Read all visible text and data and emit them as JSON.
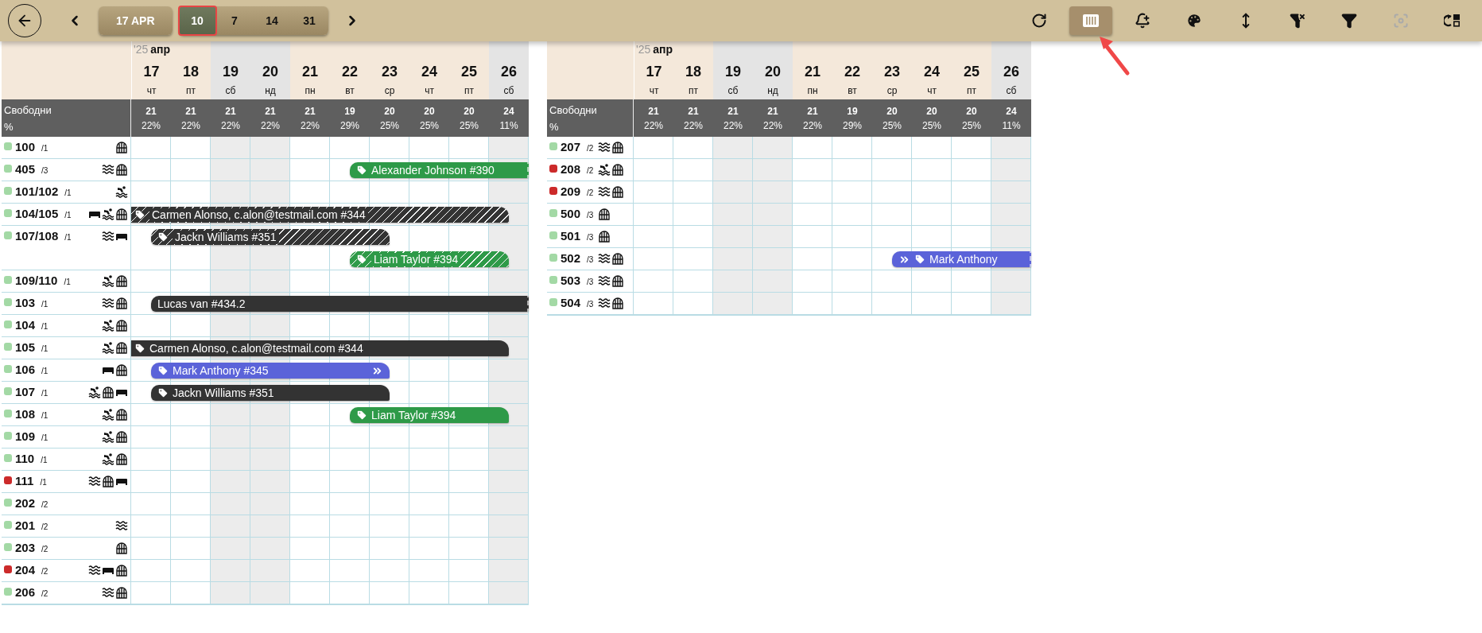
{
  "toolbar": {
    "period": "17 APR",
    "pointer_arrow": true,
    "ranges": [
      {
        "label": "10",
        "selected": true,
        "highlighted": true
      },
      {
        "label": "7",
        "selected": false,
        "highlighted": false
      },
      {
        "label": "14",
        "selected": false,
        "highlighted": false
      },
      {
        "label": "31",
        "selected": false,
        "highlighted": false
      }
    ],
    "tools": [
      {
        "kind": "refresh",
        "active": false,
        "disabled": false
      },
      {
        "kind": "columns",
        "active": true,
        "disabled": false
      },
      {
        "kind": "bell-plus",
        "active": false,
        "disabled": false
      },
      {
        "kind": "palette",
        "active": false,
        "disabled": false
      },
      {
        "kind": "height",
        "active": false,
        "disabled": false
      },
      {
        "kind": "filter-off",
        "active": false,
        "disabled": false
      },
      {
        "kind": "filter",
        "active": false,
        "disabled": false
      },
      {
        "kind": "focus",
        "active": false,
        "disabled": true
      },
      {
        "kind": "swap-layout",
        "active": false,
        "disabled": false
      }
    ]
  },
  "panels": [
    {
      "year": "'25",
      "month": "апр",
      "free_label": "Свободни",
      "pct_label": "%",
      "days": [
        {
          "date": "17",
          "weekday": "чт",
          "weekend": false,
          "free": "21",
          "pct": "22%"
        },
        {
          "date": "18",
          "weekday": "пт",
          "weekend": false,
          "free": "21",
          "pct": "22%"
        },
        {
          "date": "19",
          "weekday": "сб",
          "weekend": true,
          "free": "21",
          "pct": "22%"
        },
        {
          "date": "20",
          "weekday": "нд",
          "weekend": true,
          "free": "21",
          "pct": "22%"
        },
        {
          "date": "21",
          "weekday": "пн",
          "weekend": false,
          "free": "21",
          "pct": "22%"
        },
        {
          "date": "22",
          "weekday": "вт",
          "weekend": false,
          "free": "19",
          "pct": "29%"
        },
        {
          "date": "23",
          "weekday": "ср",
          "weekend": false,
          "free": "20",
          "pct": "25%"
        },
        {
          "date": "24",
          "weekday": "чт",
          "weekend": false,
          "free": "20",
          "pct": "25%"
        },
        {
          "date": "25",
          "weekday": "пт",
          "weekend": false,
          "free": "20",
          "pct": "25%"
        },
        {
          "date": "26",
          "weekday": "сб",
          "weekend": true,
          "free": "24",
          "pct": "11%"
        }
      ],
      "rows": [
        {
          "room": "100",
          "capacity": "/1",
          "color": "#a3d9a5",
          "features": [
            {
              "kind": "window"
            }
          ]
        },
        {
          "room": "405",
          "capacity": "/3",
          "color": "#a3d9a5",
          "features": [
            {
              "kind": "sea"
            },
            {
              "kind": "window"
            }
          ],
          "lanes": [
            [
              {
                "guest": "Alexander Johnson #390",
                "color": "#2e9a48",
                "striped": false,
                "tag": true,
                "linked_before": false,
                "linked_after": false
              }
            ]
          ]
        },
        {
          "room": "101/102",
          "capacity": "/1",
          "color": "#a3d9a5",
          "features": [
            {
              "kind": "pool"
            }
          ]
        },
        {
          "room": "104/105",
          "capacity": "/1",
          "color": "#a3d9a5",
          "features": [
            {
              "kind": "bed"
            },
            {
              "kind": "pool"
            },
            {
              "kind": "window"
            }
          ],
          "lanes": [
            [
              {
                "guest": "Carmen Alonso, c.alon@testmail.com #344",
                "color": "#333333",
                "striped": true,
                "tag": true,
                "linked_before": false,
                "linked_after": false
              }
            ]
          ]
        },
        {
          "room": "107/108",
          "capacity": "/1",
          "color": "#a3d9a5",
          "features": [
            {
              "kind": "sea"
            },
            {
              "kind": "bed"
            }
          ],
          "lanes": [
            [
              {
                "guest": "Jackn Williams #351",
                "color": "#333333",
                "striped": true,
                "tag": true,
                "linked_before": false,
                "linked_after": false
              }
            ],
            [
              {
                "guest": "Liam Taylor #394",
                "color": "#2e9a48",
                "striped": true,
                "tag": true,
                "linked_before": false,
                "linked_after": false
              }
            ]
          ]
        },
        {
          "room": "109/110",
          "capacity": "/1",
          "color": "#a3d9a5",
          "features": [
            {
              "kind": "pool"
            },
            {
              "kind": "window"
            }
          ]
        },
        {
          "room": "103",
          "capacity": "/1",
          "color": "#a3d9a5",
          "features": [
            {
              "kind": "sea"
            },
            {
              "kind": "window"
            }
          ],
          "lanes": [
            [
              {
                "guest": "Lucas van #434.2",
                "color": "#333333",
                "striped": false,
                "tag": false,
                "linked_before": false,
                "linked_after": false
              }
            ]
          ]
        },
        {
          "room": "104",
          "capacity": "/1",
          "color": "#a3d9a5",
          "features": [
            {
              "kind": "pool"
            },
            {
              "kind": "window"
            }
          ]
        },
        {
          "room": "105",
          "capacity": "/1",
          "color": "#a3d9a5",
          "features": [
            {
              "kind": "pool"
            },
            {
              "kind": "window"
            }
          ],
          "lanes": [
            [
              {
                "guest": "Carmen Alonso, c.alon@testmail.com #344",
                "color": "#333333",
                "striped": false,
                "tag": true,
                "linked_before": false,
                "linked_after": false
              }
            ]
          ]
        },
        {
          "room": "106",
          "capacity": "/1",
          "color": "#a3d9a5",
          "features": [
            {
              "kind": "bed"
            },
            {
              "kind": "window"
            }
          ],
          "lanes": [
            [
              {
                "guest": "Mark Anthony #345",
                "color": "#5b63d9",
                "striped": false,
                "tag": true,
                "linked_before": false,
                "linked_after": true
              }
            ]
          ]
        },
        {
          "room": "107",
          "capacity": "/1",
          "color": "#a3d9a5",
          "features": [
            {
              "kind": "pool"
            },
            {
              "kind": "window"
            },
            {
              "kind": "bed"
            }
          ],
          "lanes": [
            [
              {
                "guest": "Jackn Williams #351",
                "color": "#333333",
                "striped": false,
                "tag": true,
                "linked_before": false,
                "linked_after": false
              }
            ]
          ]
        },
        {
          "room": "108",
          "capacity": "/1",
          "color": "#a3d9a5",
          "features": [
            {
              "kind": "pool"
            },
            {
              "kind": "window"
            }
          ],
          "lanes": [
            [
              {
                "guest": "Liam Taylor #394",
                "color": "#2e9a48",
                "striped": false,
                "tag": true,
                "linked_before": false,
                "linked_after": false
              }
            ]
          ]
        },
        {
          "room": "109",
          "capacity": "/1",
          "color": "#a3d9a5",
          "features": [
            {
              "kind": "pool"
            },
            {
              "kind": "window"
            }
          ]
        },
        {
          "room": "110",
          "capacity": "/1",
          "color": "#a3d9a5",
          "features": [
            {
              "kind": "pool"
            },
            {
              "kind": "window"
            }
          ]
        },
        {
          "room": "111",
          "capacity": "/1",
          "color": "#cc2a2a",
          "features": [
            {
              "kind": "sea"
            },
            {
              "kind": "window"
            },
            {
              "kind": "bed"
            }
          ]
        },
        {
          "room": "202",
          "capacity": "/2",
          "color": "#a3d9a5"
        },
        {
          "room": "201",
          "capacity": "/2",
          "color": "#a3d9a5",
          "features": [
            {
              "kind": "sea"
            }
          ]
        },
        {
          "room": "203",
          "capacity": "/2",
          "color": "#a3d9a5",
          "features": [
            {
              "kind": "window"
            }
          ]
        },
        {
          "room": "204",
          "capacity": "/2",
          "color": "#cc2a2a",
          "features": [
            {
              "kind": "sea"
            },
            {
              "kind": "bed"
            },
            {
              "kind": "window"
            }
          ]
        },
        {
          "room": "206",
          "capacity": "/2",
          "color": "#a3d9a5",
          "features": [
            {
              "kind": "sea"
            },
            {
              "kind": "window"
            }
          ]
        }
      ]
    },
    {
      "year": "'25",
      "month": "апр",
      "free_label": "Свободни",
      "pct_label": "%",
      "days": [
        {
          "date": "17",
          "weekday": "чт",
          "weekend": false,
          "free": "21",
          "pct": "22%"
        },
        {
          "date": "18",
          "weekday": "пт",
          "weekend": false,
          "free": "21",
          "pct": "22%"
        },
        {
          "date": "19",
          "weekday": "сб",
          "weekend": true,
          "free": "21",
          "pct": "22%"
        },
        {
          "date": "20",
          "weekday": "нд",
          "weekend": true,
          "free": "21",
          "pct": "22%"
        },
        {
          "date": "21",
          "weekday": "пн",
          "weekend": false,
          "free": "21",
          "pct": "22%"
        },
        {
          "date": "22",
          "weekday": "вт",
          "weekend": false,
          "free": "19",
          "pct": "29%"
        },
        {
          "date": "23",
          "weekday": "ср",
          "weekend": false,
          "free": "20",
          "pct": "25%"
        },
        {
          "date": "24",
          "weekday": "чт",
          "weekend": false,
          "free": "20",
          "pct": "25%"
        },
        {
          "date": "25",
          "weekday": "пт",
          "weekend": false,
          "free": "20",
          "pct": "25%"
        },
        {
          "date": "26",
          "weekday": "сб",
          "weekend": true,
          "free": "24",
          "pct": "11%"
        }
      ],
      "rows": [
        {
          "room": "207",
          "capacity": "/2",
          "color": "#a3d9a5",
          "features": [
            {
              "kind": "sea"
            },
            {
              "kind": "window"
            }
          ]
        },
        {
          "room": "208",
          "capacity": "/2",
          "color": "#cc2a2a",
          "features": [
            {
              "kind": "pool"
            },
            {
              "kind": "window"
            }
          ]
        },
        {
          "room": "209",
          "capacity": "/2",
          "color": "#cc2a2a",
          "features": [
            {
              "kind": "sea"
            },
            {
              "kind": "window"
            }
          ]
        },
        {
          "room": "500",
          "capacity": "/3",
          "color": "#a3d9a5",
          "features": [
            {
              "kind": "window"
            }
          ]
        },
        {
          "room": "501",
          "capacity": "/3",
          "color": "#a3d9a5",
          "features": [
            {
              "kind": "window"
            }
          ]
        },
        {
          "room": "502",
          "capacity": "/3",
          "color": "#a3d9a5",
          "features": [
            {
              "kind": "sea"
            },
            {
              "kind": "window"
            }
          ],
          "lanes": [
            [
              {
                "guest": "Mark Anthony",
                "color": "#5b63d9",
                "striped": false,
                "tag": true,
                "linked_before": true,
                "linked_after": false
              }
            ]
          ]
        },
        {
          "room": "503",
          "capacity": "/3",
          "color": "#a3d9a5",
          "features": [
            {
              "kind": "sea"
            },
            {
              "kind": "window"
            }
          ]
        },
        {
          "room": "504",
          "capacity": "/3",
          "color": "#a3d9a5",
          "features": [
            {
              "kind": "sea"
            },
            {
              "kind": "window"
            }
          ]
        }
      ]
    }
  ]
}
